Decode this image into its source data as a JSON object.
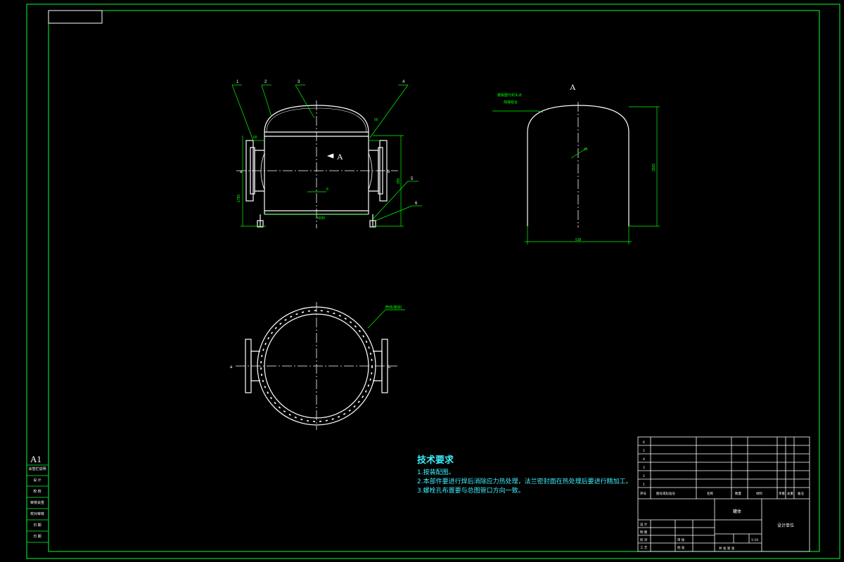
{
  "drawing": {
    "sheet_size": "A1",
    "view_label": "A",
    "section_marker": "A",
    "nozzle_left": "a",
    "nozzle_right": "b",
    "balloons": [
      "1",
      "2",
      "3",
      "4"
    ],
    "balloons_right": [
      "5",
      "6"
    ],
    "dims": {
      "top_left_small": "60",
      "top_right_small": "60",
      "left_vertical": "1785",
      "right_vertical": "355",
      "inner_width": "6695",
      "center_small": "8",
      "view_height": "3565",
      "view_width": "538",
      "view_leader": "45"
    },
    "leader_note_view": [
      "钢板圈与封头点",
      "焊接组合"
    ],
    "leader_note_plan": "筒体(卷焊)"
  },
  "tech_requirements": {
    "title": "技术要求",
    "lines": [
      "1.按装配图。",
      "2.本部件要进行焊后消除应力热处理，法兰密封面在热处理后要进行精加工。",
      "3.螺栓孔布置要与总图管口方向一致。"
    ]
  },
  "side_block": [
    "会签栏说明",
    "设 计",
    "校 核",
    "审核会签",
    "校对审核",
    "日 期",
    "日 期"
  ],
  "title_block": {
    "rows_num": [
      "6",
      "5",
      "4",
      "3",
      "2",
      "1"
    ],
    "col_headers": [
      "序号",
      "图号或标准号",
      "名称",
      "数量",
      "材料",
      "单重",
      "总重",
      "备注"
    ],
    "footer_left": [
      "设 计",
      "制 图",
      "校 对",
      "工 艺",
      "审 核",
      "批 准"
    ],
    "drawing_name": "罐体",
    "company": "设计单位",
    "scale": "1:10",
    "sheet": "共  张  第  张"
  },
  "colors": {
    "frame": "#00ff33",
    "geometry": "#ffffff",
    "dimension": "#00ff00",
    "text_cyan": "#3ef0ff"
  }
}
